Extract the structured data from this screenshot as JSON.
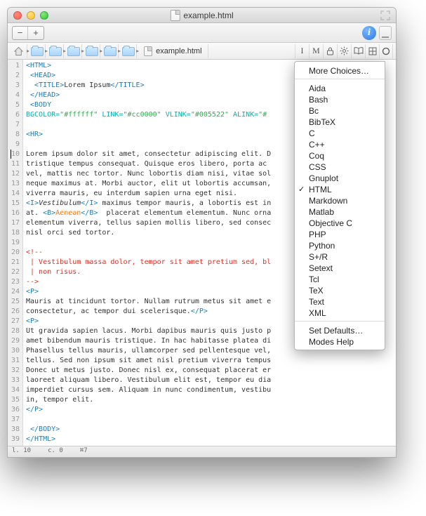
{
  "window": {
    "title": "example.html"
  },
  "toolbar": {
    "minus": "−",
    "plus": "+",
    "info": "i"
  },
  "nav": {
    "filename": "example.html",
    "icons": [
      "I",
      "M",
      "lock",
      "gear",
      "book",
      "grid",
      "circle"
    ]
  },
  "gutter": {
    "count": 39
  },
  "code": {
    "l1": "<HTML>",
    "l2": " <HEAD>",
    "l3a": "  <TITLE>",
    "l3b": "Lorem Ipsum",
    "l3c": "</TITLE>",
    "l4": " </HEAD>",
    "l5": " <BODY",
    "l6a": "BGCOLOR=",
    "l6b": "\"#ffffff\"",
    "l6c": " LINK=",
    "l6d": "\"#cc0000\"",
    "l6e": " VLINK=",
    "l6f": "\"#005522\"",
    "l6g": " ALINK=",
    "l6h": "\"#",
    "l7": "",
    "l8": "<HR>",
    "l9": "",
    "l10": "Lorem ipsum dolor sit amet, consectetur adipiscing elit. D",
    "l11": "tristique tempus consequat. Quisque eros libero, porta ac",
    "l12": "vel, mattis nec tortor. Nunc lobortis diam nisi, vitae sol",
    "l13": "neque maximus at. Morbi auctor, elit ut lobortis accumsan,",
    "l14": "viverra mauris, eu interdum sapien urna eget nisi.",
    "l15a": "<I>",
    "l15b": "Vestibulum",
    "l15c": "</I>",
    "l15d": " maximus tempor mauris, a lobortis est in",
    "l16a": "at. ",
    "l16b": "<B>",
    "l16c": "Aenean",
    "l16d": "</B>",
    "l16e": "  placerat elementum elementum. Nunc orna",
    "l17": "elementum viverra, tellus sapien mollis libero, sed consec",
    "l18": "nisl orci sed tortor.",
    "l19": "",
    "l20": "<!--",
    "l21": " | Vestibulum massa dolor, tempor sit amet pretium sed, bl",
    "l22": " | non risus.",
    "l23": "-->",
    "l24": "<P>",
    "l25": "Mauris at tincidunt tortor. Nullam rutrum metus sit amet e",
    "l26a": "consectetur, ac tempor dui scelerisque.",
    "l26b": "</P>",
    "l27": "<P>",
    "l28": "Ut gravida sapien lacus. Morbi dapibus mauris quis justo p",
    "l29": "amet bibendum mauris tristique. In hac habitasse platea di",
    "l30": "Phasellus tellus mauris, ullamcorper sed pellentesque vel,",
    "l31": "tellus. Sed non ipsum sit amet nisl pretium viverra tempus",
    "l32": "Donec ut metus justo. Donec nisl ex, consequat placerat er",
    "l33": "laoreet aliquam libero. Vestibulum elit est, tempor eu dia",
    "l34": "imperdiet cursus sem. Aliquam in nunc condimentum, vestibu",
    "l35": "in, tempor elit.",
    "l36": "</P>",
    "l37": "",
    "l38": " </BODY>",
    "l39": "</HTML>"
  },
  "status": {
    "line": "l. 10",
    "col": "c. 0",
    "sym": "⌘7"
  },
  "menu": {
    "header": "More Choices…",
    "items": [
      "Aida",
      "Bash",
      "Bc",
      "BibTeX",
      "C",
      "C++",
      "Coq",
      "CSS",
      "Gnuplot",
      "HTML",
      "Markdown",
      "Matlab",
      "Objective C",
      "PHP",
      "Python",
      "S+/R",
      "Setext",
      "Tcl",
      "TeX",
      "Text",
      "XML"
    ],
    "selected": "HTML",
    "footer1": "Set Defaults…",
    "footer2": "Modes Help"
  }
}
